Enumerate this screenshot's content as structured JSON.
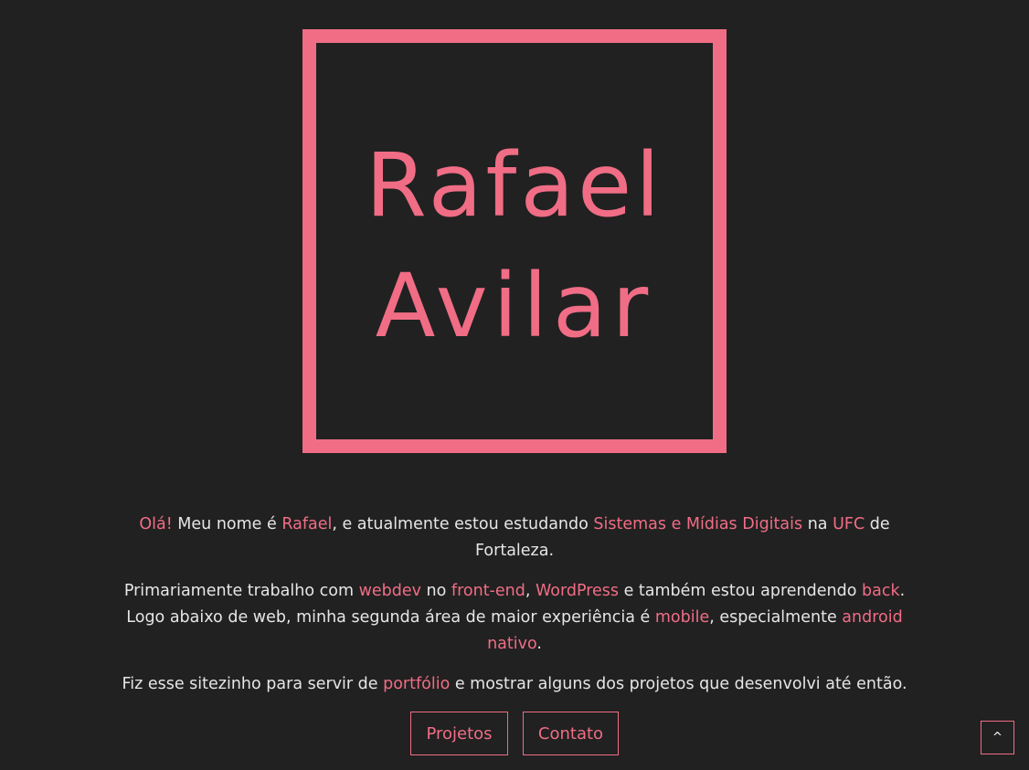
{
  "logo": {
    "first_name": "Rafael",
    "last_name": "Avilar"
  },
  "intro": {
    "p1": {
      "greeting": "Olá!",
      "t1": " Meu nome é ",
      "name": "Rafael",
      "t2": ", e atualmente estou estudando ",
      "course": "Sistemas e Mídias Digitais",
      "t3": " na ",
      "university": "UFC",
      "t4": " de Fortaleza."
    },
    "p2": {
      "t1": "Primariamente trabalho com ",
      "webdev": "webdev",
      "t2": " no ",
      "frontend": "front-end",
      "t3": ", ",
      "wordpress": "WordPress",
      "t4": " e também estou aprendendo ",
      "back": "back",
      "t5": ". Logo abaixo de web, minha segunda área de maior experiência é ",
      "mobile": "mobile",
      "t6": ", especialmente ",
      "android": "android nativo",
      "t7": "."
    },
    "p3": {
      "t1": "Fiz esse sitezinho para servir de ",
      "portfolio": "portfólio",
      "t2": " e mostrar alguns dos projetos que desenvolvi até então."
    }
  },
  "buttons": {
    "projects_label": "Projetos",
    "contact_label": "Contato",
    "back_to_top_label": "^"
  },
  "colors": {
    "background": "#212121",
    "accent": "#f06d85",
    "text": "#e6e6e6"
  }
}
